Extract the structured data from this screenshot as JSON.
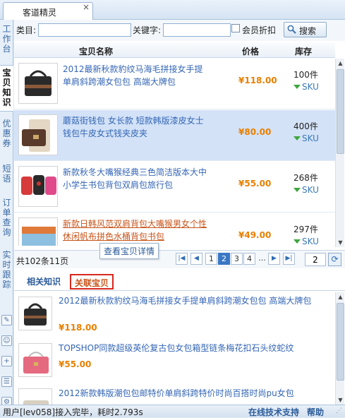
{
  "window": {
    "tab_title": "客道精灵",
    "close_glyph": "×"
  },
  "sidebar": {
    "tabs": [
      {
        "label": "工作台",
        "active": false
      },
      {
        "label": "宝贝知识",
        "active": true
      },
      {
        "label": "优惠券",
        "active": false
      },
      {
        "label": "短语",
        "active": false
      },
      {
        "label": "订单查询",
        "active": false
      },
      {
        "label": "实时跟踪",
        "active": false
      }
    ],
    "icons": [
      "pen-icon",
      "user-icon",
      "user-add-icon",
      "contacts-icon",
      "gear-icon"
    ]
  },
  "search": {
    "category_label": "类目:",
    "category_value": "",
    "keyword_label": "关键字:",
    "keyword_value": "",
    "member_discount_label": "会员折扣",
    "member_discount_checked": false,
    "button_label": "搜索"
  },
  "table": {
    "headers": {
      "name": "宝贝名称",
      "price": "价格",
      "stock": "库存"
    },
    "rows": [
      {
        "name": "2012最新秋款豹纹马海毛拼接女手提单肩斜跨潮女包包 高端大牌包",
        "price": "¥118.00",
        "stock": "100件",
        "sku": "SKU",
        "selected": false,
        "hover": false
      },
      {
        "name": "蘑菇街钱包 女长款 短款韩版漆皮女士钱包牛皮女式钱夹皮夹",
        "price": "¥80.00",
        "stock": "400件",
        "sku": "SKU",
        "selected": true,
        "hover": false
      },
      {
        "name": "新款秋冬大嘴猴经典三色简洁版本大中小学生书包背包双肩包旅行包",
        "price": "¥55.00",
        "stock": "268件",
        "sku": "SKU",
        "selected": false,
        "hover": false
      },
      {
        "name": "新款日韩风范双肩背包大嘴猴男女个性休闲帆布拼色水桶背包书包",
        "price": "¥49.00",
        "stock": "297件",
        "sku": "SKU",
        "selected": false,
        "hover": true
      }
    ]
  },
  "pager": {
    "summary": "共102条11页",
    "pages": [
      "1",
      "2",
      "3",
      "4"
    ],
    "current_page": "2",
    "ellipsis": "...",
    "goto_value": "2"
  },
  "tooltip": "查看宝贝详情",
  "bottom_tabs": {
    "related_knowledge": "相关知识",
    "related_items": "关联宝贝",
    "active": "related_items"
  },
  "related_items": [
    {
      "name": "2012最新秋款豹纹马海毛拼接女手提单肩斜跨潮女包包 高端大牌包",
      "price": "¥118.00"
    },
    {
      "name": "TOPSHOP同款超级英伦复古包女包箱型链条梅花扣石头纹蛇纹",
      "price": "¥55.00"
    },
    {
      "name": "2012新款韩版潮包包邮特价单肩斜跨特价时尚百搭时尚pu女包",
      "price": ""
    }
  ],
  "status": {
    "message": "用户[lev058]接入完毕，耗时2.793s",
    "support_link": "在线技术支持",
    "help_link": "帮助"
  },
  "colors": {
    "accent": "#3a78c4",
    "price": "#e88000",
    "link": "#3466b5",
    "active_tab_border": "#d9281e",
    "selected_row": "#d3e2f7"
  }
}
